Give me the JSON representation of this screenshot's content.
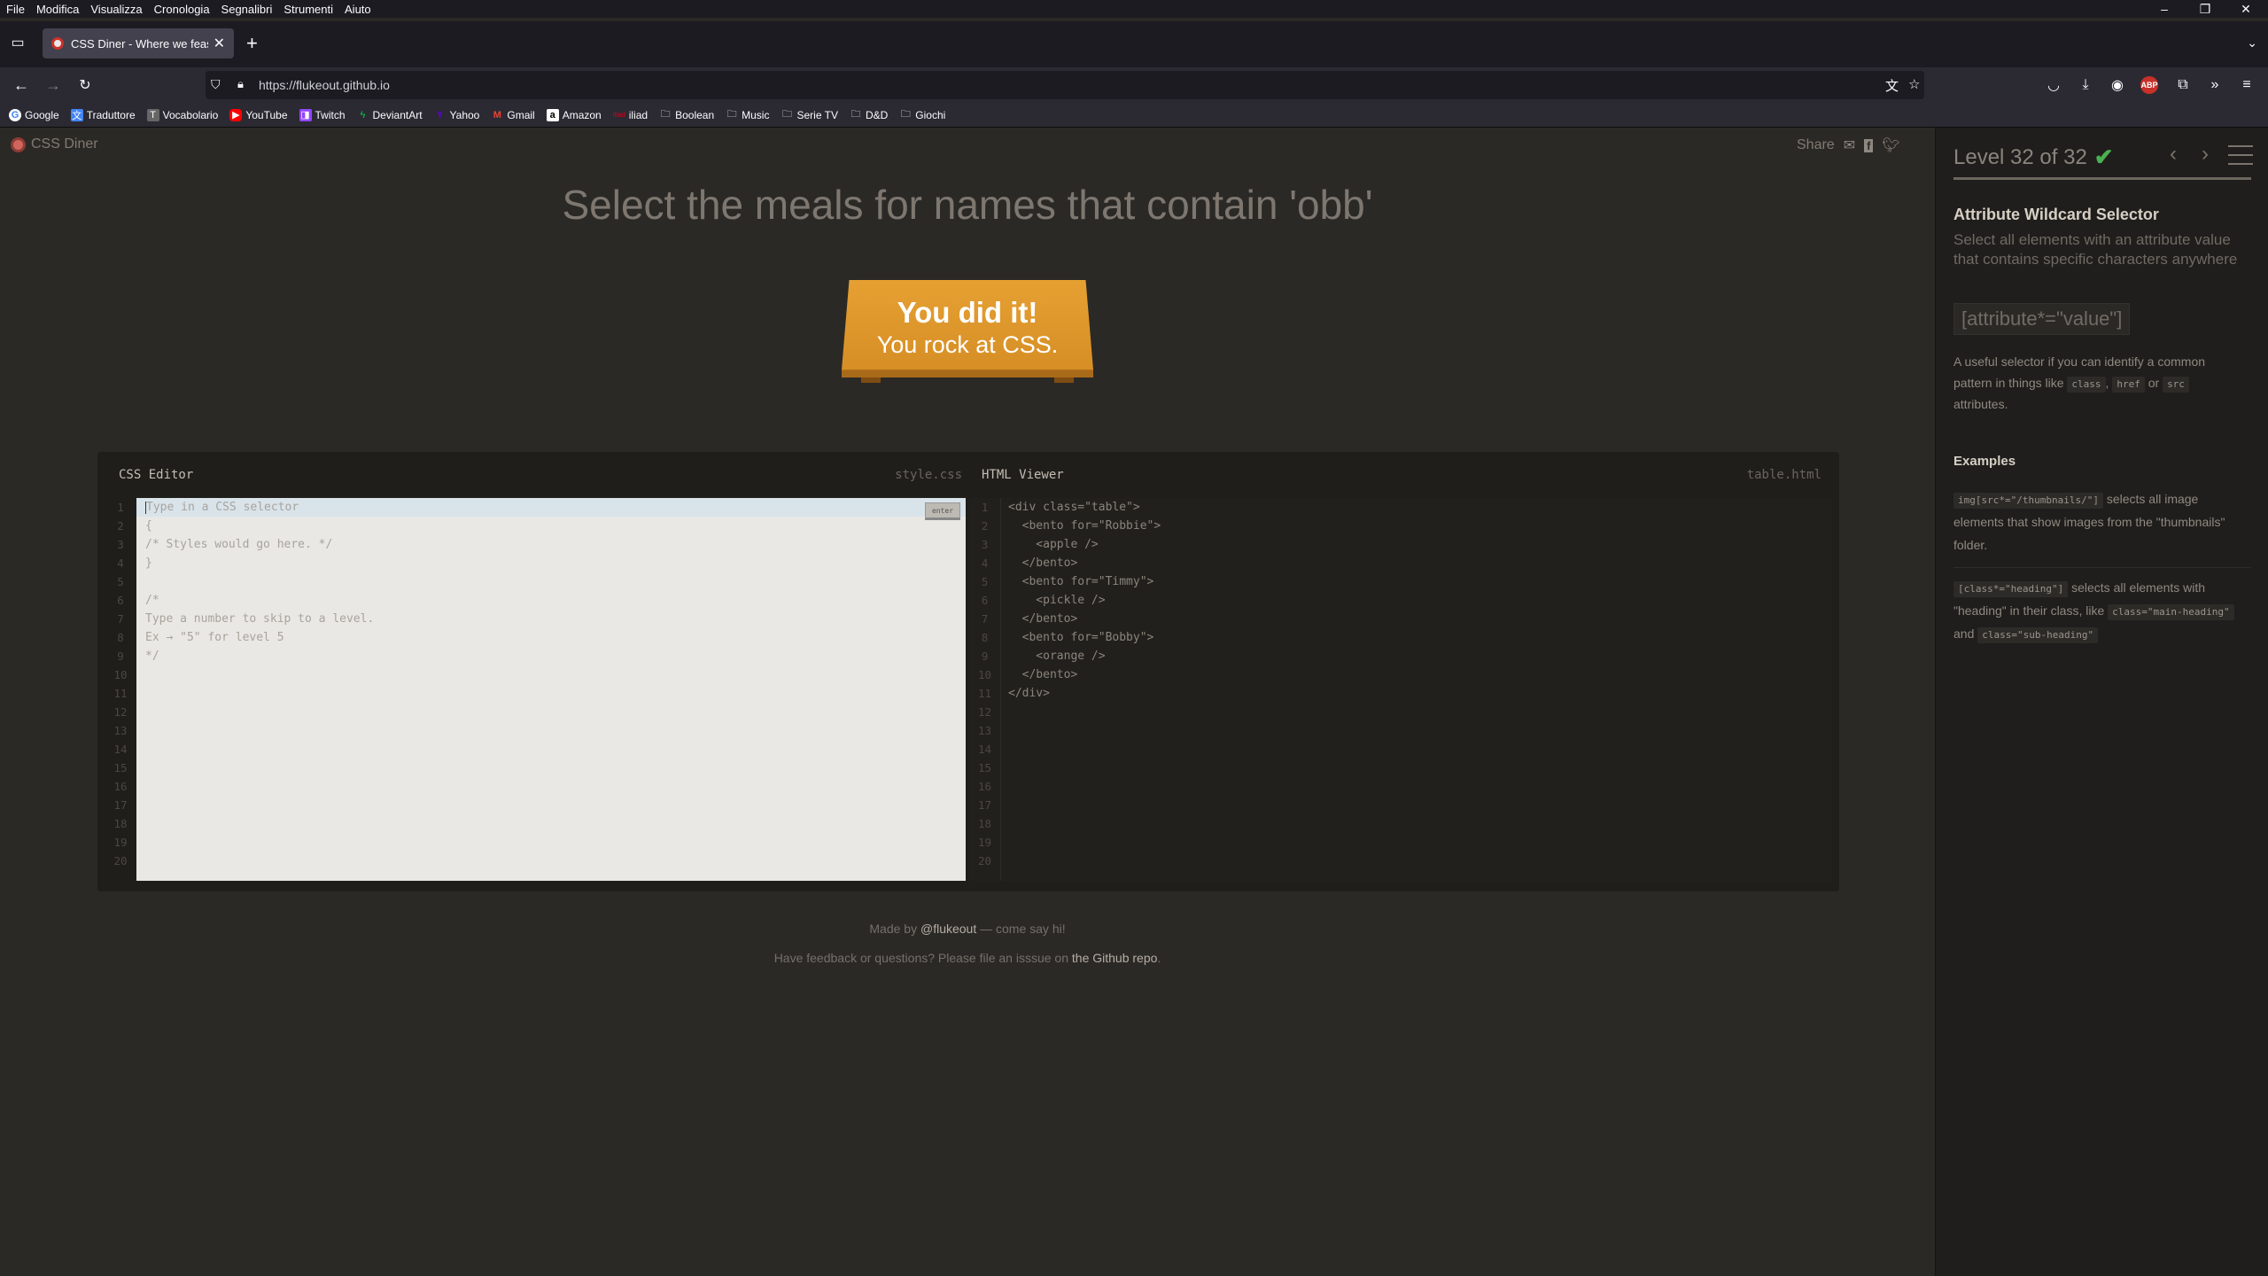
{
  "menubar": [
    "File",
    "Modifica",
    "Visualizza",
    "Cronologia",
    "Segnalibri",
    "Strumenti",
    "Aiuto"
  ],
  "tab": {
    "title": "CSS Diner - Where we feast on CSS"
  },
  "url": "https://flukeout.github.io",
  "bookmarks": [
    {
      "label": "Google",
      "icon": "google-icon"
    },
    {
      "label": "Traduttore",
      "icon": "translate-icon"
    },
    {
      "label": "Vocabolario",
      "icon": "book-icon"
    },
    {
      "label": "YouTube",
      "icon": "youtube-icon"
    },
    {
      "label": "Twitch",
      "icon": "twitch-icon"
    },
    {
      "label": "DeviantArt",
      "icon": "deviantart-icon"
    },
    {
      "label": "Yahoo",
      "icon": "yahoo-icon"
    },
    {
      "label": "Gmail",
      "icon": "gmail-icon"
    },
    {
      "label": "Amazon",
      "icon": "amazon-icon"
    },
    {
      "label": "iliad",
      "icon": "iliad-icon"
    },
    {
      "label": "Boolean",
      "icon": "folder-icon"
    },
    {
      "label": "Music",
      "icon": "folder-icon"
    },
    {
      "label": "Serie TV",
      "icon": "folder-icon"
    },
    {
      "label": "D&D",
      "icon": "folder-icon"
    },
    {
      "label": "Giochi",
      "icon": "folder-icon"
    }
  ],
  "page": {
    "logo": "CSS Diner",
    "share": "Share",
    "order": "Select the meals for names that contain 'obb'",
    "plate": {
      "line1": "You did it!",
      "line2": "You rock at CSS."
    },
    "css_editor": {
      "title": "CSS Editor",
      "file": "style.css",
      "enter": "enter",
      "lines": [
        "Type in a CSS selector",
        "{",
        "/* Styles would go here. */",
        "}",
        "",
        "/*",
        "Type a number to skip to a level.",
        "Ex → \"5\" for level 5",
        "*/",
        "",
        "",
        "",
        "",
        "",
        "",
        "",
        "",
        "",
        "",
        ""
      ]
    },
    "html_viewer": {
      "title": "HTML Viewer",
      "file": "table.html",
      "lines": [
        "<div class=\"table\">",
        "  <bento for=\"Robbie\">",
        "    <apple />",
        "  </bento>",
        "  <bento for=\"Timmy\">",
        "    <pickle />",
        "  </bento>",
        "  <bento for=\"Bobby\">",
        "    <orange />",
        "  </bento>",
        "</div>",
        "",
        "",
        "",
        "",
        "",
        "",
        "",
        "",
        ""
      ]
    },
    "footer": {
      "made_by": "Made by",
      "handle": "@flukeout",
      "say_hi": "— come say hi!",
      "feedback": "Have feedback or questions? Please file an isssue on",
      "repo": "the Github repo",
      "period": "."
    }
  },
  "sidebar": {
    "level": "Level 32 of 32",
    "progress_fraction": 1.0,
    "title": "Attribute Wildcard Selector",
    "subtitle": "Select all elements with an attribute value that contains specific characters anywhere",
    "syntax": "[attribute*=\"value\"]",
    "hint_pre": "A useful selector if you can identify a common pattern in things like",
    "hint_tag1": "class",
    "hint_sep": ",",
    "hint_tag2": "href",
    "hint_or": "or",
    "hint_tag3": "src",
    "hint_post": "attributes.",
    "examples_title": "Examples",
    "ex1_code": "img[src*=\"/thumbnails/\"]",
    "ex1_text": "selects all image elements that show images from the \"thumbnails\" folder.",
    "ex2_code": "[class*=\"heading\"]",
    "ex2_text_a": "selects all elements with \"heading\" in their class, like",
    "ex2_code2": "class=\"main-heading\"",
    "ex2_and": "and",
    "ex2_code3": "class=\"sub-heading\""
  }
}
